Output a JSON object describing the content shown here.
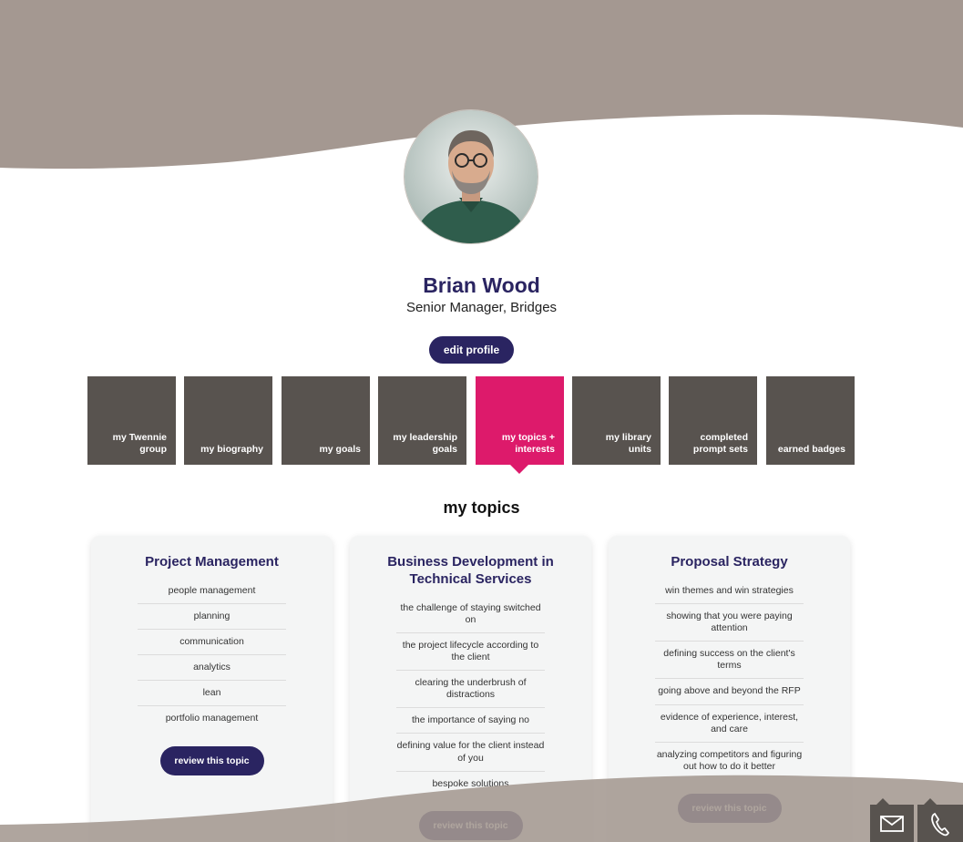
{
  "colors": {
    "wave": "#a49891",
    "navy": "#2a2461",
    "tab": "#58534f",
    "active_tab": "#dd1a6b",
    "card": "#f4f5f5"
  },
  "profile": {
    "name": "Brian Wood",
    "role": "Senior Manager, Bridges",
    "edit_label": "edit profile"
  },
  "tabs": [
    {
      "label": "my Twennie group",
      "active": false
    },
    {
      "label": "my biography",
      "active": false
    },
    {
      "label": "my goals",
      "active": false
    },
    {
      "label": "my leadership goals",
      "active": false
    },
    {
      "label": "my topics + interests",
      "active": true
    },
    {
      "label": "my library units",
      "active": false
    },
    {
      "label": "completed prompt sets",
      "active": false
    },
    {
      "label": "earned badges",
      "active": false
    }
  ],
  "section_title": "my topics",
  "cards": [
    {
      "title": "Project Management",
      "items": [
        "people management",
        "planning",
        "communication",
        "analytics",
        "lean",
        "portfolio management"
      ],
      "button": "review this topic"
    },
    {
      "title": "Business Development in Technical Services",
      "items": [
        "the challenge of staying switched on",
        "the project lifecycle according to the client",
        "clearing the underbrush of distractions",
        "the importance of saying no",
        "defining value for the client instead of you",
        "bespoke solutions"
      ],
      "button": "review this topic"
    },
    {
      "title": "Proposal Strategy",
      "items": [
        "win themes and win strategies",
        "showing that you were paying attention",
        "defining success on the client's terms",
        "going above and beyond the RFP",
        "evidence of experience, interest, and care",
        "analyzing competitors and figuring out how to do it better"
      ],
      "button": "review this topic"
    }
  ],
  "icons": {
    "avatar": "profile-photo",
    "email": "envelope-icon",
    "phone": "phone-icon"
  }
}
